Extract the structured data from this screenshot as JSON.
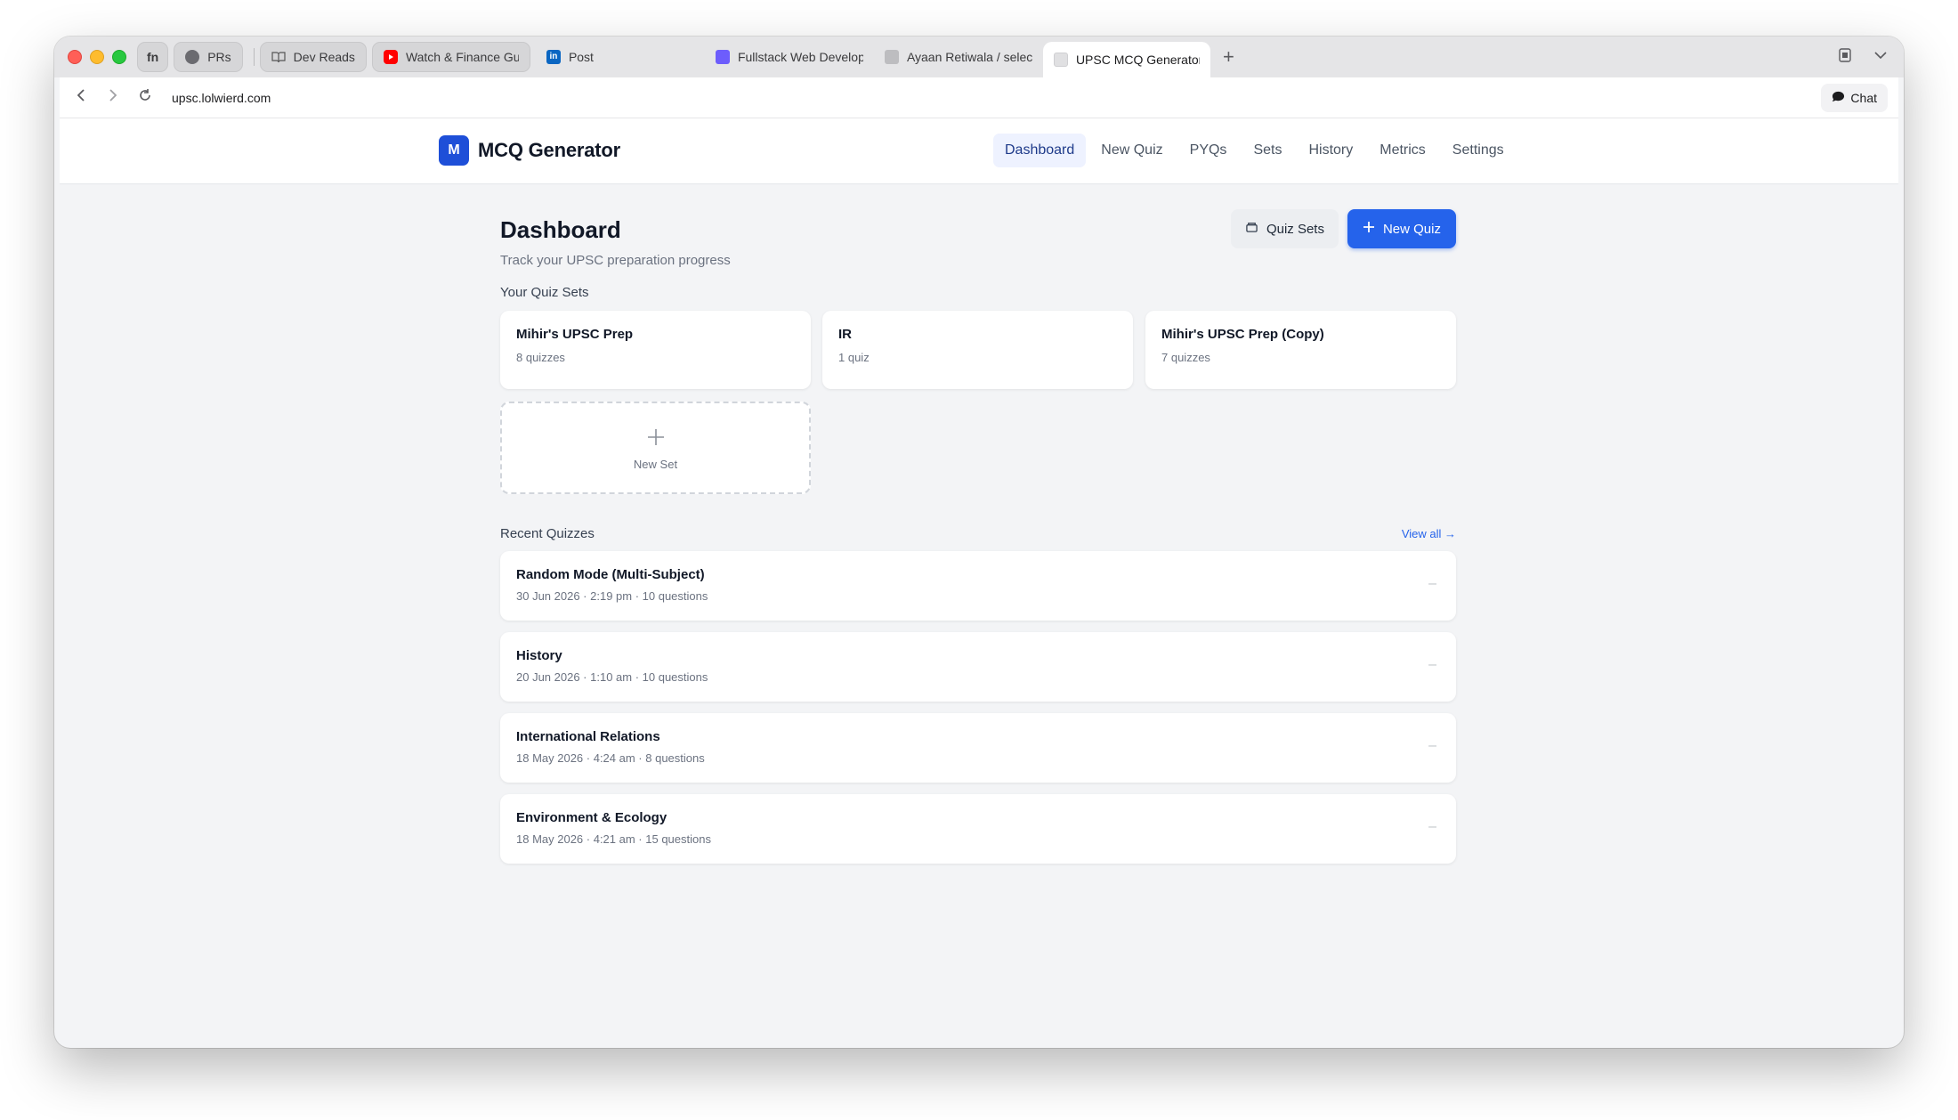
{
  "browser": {
    "tabs": [
      {
        "label": "fn",
        "kind": "pinned"
      },
      {
        "label": "PRs",
        "kind": "pinned"
      },
      {
        "label": "Dev Reads",
        "kind": "pinned"
      },
      {
        "label": "Watch & Finance Guid",
        "kind": "pinned"
      },
      {
        "label": "Post",
        "kind": "plain"
      },
      {
        "label": "Fullstack Web Develop",
        "kind": "plain"
      },
      {
        "label": "Ayaan Retiwala / select",
        "kind": "plain"
      },
      {
        "label": "UPSC MCQ Generator",
        "kind": "active"
      }
    ],
    "url": "upsc.lolwierd.com",
    "chat_label": "Chat"
  },
  "app": {
    "logo_letter": "M",
    "brand": "MCQ Generator",
    "nav": [
      "Dashboard",
      "New Quiz",
      "PYQs",
      "Sets",
      "History",
      "Metrics",
      "Settings"
    ],
    "active_nav": "Dashboard",
    "accent": "#2563eb"
  },
  "dashboard": {
    "title": "Dashboard",
    "subtitle": "Track your UPSC preparation progress",
    "quiz_sets_button": "Quiz Sets",
    "new_quiz_button": "New Quiz",
    "sets_heading": "Your Quiz Sets",
    "sets": [
      {
        "name": "Mihir's UPSC Prep",
        "count": "8 quizzes"
      },
      {
        "name": "IR",
        "count": "1 quiz"
      },
      {
        "name": "Mihir's UPSC Prep (Copy)",
        "count": "7 quizzes"
      }
    ],
    "new_set_label": "New Set",
    "recent_heading": "Recent Quizzes",
    "view_all": "View all →",
    "recent": [
      {
        "title": "Random Mode (Multi-Subject)",
        "meta": "30 Jun 2026 · 2:19 pm · 10 questions"
      },
      {
        "title": "History",
        "meta": "20 Jun 2026 · 1:10 am · 10 questions"
      },
      {
        "title": "International Relations",
        "meta": "18 May 2026 · 4:24 am · 8 questions"
      },
      {
        "title": "Environment & Ecology",
        "meta": "18 May 2026 · 4:21 am · 15 questions"
      }
    ],
    "row_status": "–"
  }
}
